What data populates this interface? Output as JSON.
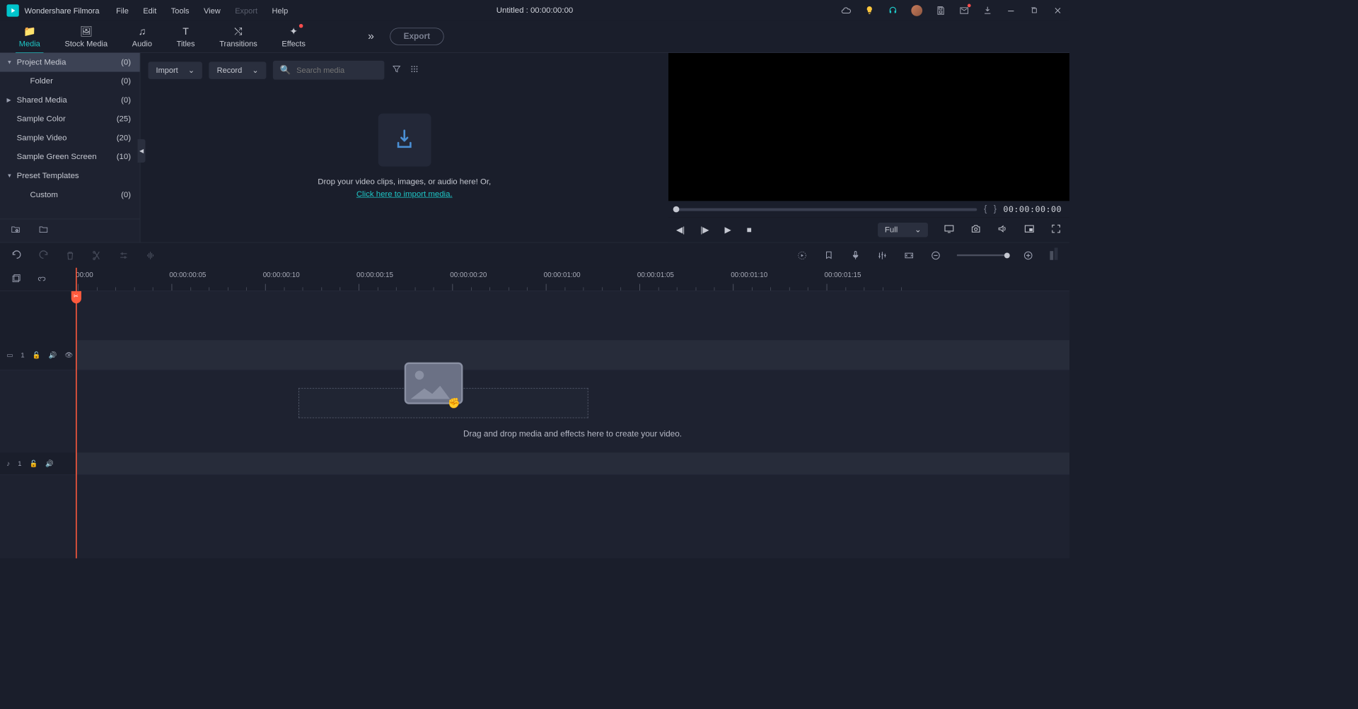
{
  "app_title": "Wondershare Filmora",
  "menu": [
    "File",
    "Edit",
    "Tools",
    "View",
    "Export",
    "Help"
  ],
  "menu_disabled_index": 4,
  "document_title": "Untitled : 00:00:00:00",
  "nav_tabs": [
    {
      "label": "Media",
      "icon": "📁"
    },
    {
      "label": "Stock Media",
      "icon": "🖼"
    },
    {
      "label": "Audio",
      "icon": "♫"
    },
    {
      "label": "Titles",
      "icon": "T"
    },
    {
      "label": "Transitions",
      "icon": "⤭"
    },
    {
      "label": "Effects",
      "icon": "✦"
    }
  ],
  "export_label": "Export",
  "sidebar": [
    {
      "label": "Project Media",
      "count": "(0)",
      "chev": "▼",
      "selected": true
    },
    {
      "label": "Folder",
      "count": "(0)",
      "indent": true
    },
    {
      "label": "Shared Media",
      "count": "(0)",
      "chev": "▶"
    },
    {
      "label": "Sample Color",
      "count": "(25)"
    },
    {
      "label": "Sample Video",
      "count": "(20)"
    },
    {
      "label": "Sample Green Screen",
      "count": "(10)"
    },
    {
      "label": "Preset Templates",
      "count": "",
      "chev": "▼"
    },
    {
      "label": "Custom",
      "count": "(0)",
      "indent": true
    }
  ],
  "import_btn": "Import",
  "record_btn": "Record",
  "search_placeholder": "Search media",
  "drop_text_1": "Drop your video clips, images, or audio here! Or,",
  "drop_link": "Click here to import media.",
  "preview_time": "00:00:00:00",
  "quality_label": "Full",
  "ruler_times": [
    "00:00",
    "00:00:00:05",
    "00:00:00:10",
    "00:00:00:15",
    "00:00:00:20",
    "00:00:01:00",
    "00:00:01:05",
    "00:00:01:10",
    "00:00:01:15"
  ],
  "timeline_hint": "Drag and drop media and effects here to create your video.",
  "video_track_label": "1",
  "audio_track_label": "1"
}
